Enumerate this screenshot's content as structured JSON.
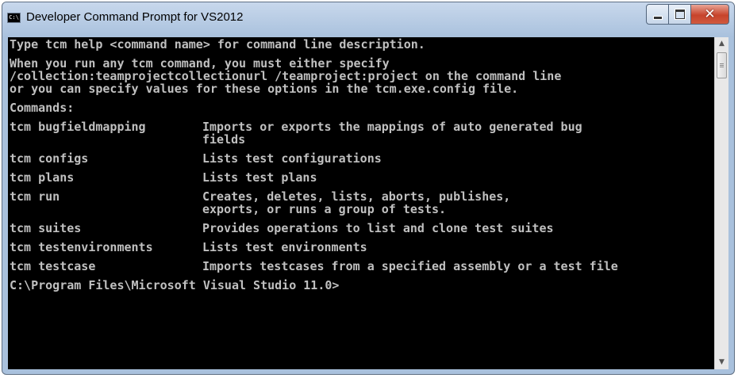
{
  "window": {
    "icon_text": "C:\\",
    "title": "Developer Command Prompt for VS2012"
  },
  "console": {
    "intro": "Type tcm help <command name> for command line description.",
    "para": [
      "When you run any tcm command, you must either specify",
      "/collection:teamprojectcollectionurl /teamproject:project on the command line",
      "or you can specify values for these options in the tcm.exe.config file."
    ],
    "commands_header": "Commands:",
    "commands": [
      {
        "name": "tcm bugfieldmapping",
        "desc": [
          "Imports or exports the mappings of auto generated bug",
          "fields"
        ]
      },
      {
        "name": "tcm configs",
        "desc": [
          "Lists test configurations"
        ]
      },
      {
        "name": "tcm plans",
        "desc": [
          "Lists test plans"
        ]
      },
      {
        "name": "tcm run",
        "desc": [
          "Creates, deletes, lists, aborts, publishes,",
          "exports, or runs a group of tests."
        ]
      },
      {
        "name": "tcm suites",
        "desc": [
          "Provides operations to list and clone test suites"
        ]
      },
      {
        "name": "tcm testenvironments",
        "desc": [
          "Lists test environments"
        ]
      },
      {
        "name": "tcm testcase",
        "desc": [
          "Imports testcases from a specified assembly or a test file"
        ]
      }
    ],
    "prompt": "C:\\Program Files\\Microsoft Visual Studio 11.0>"
  },
  "scrollbar": {
    "up_icon": "arrow-up-icon",
    "down_icon": "arrow-down-icon"
  },
  "colors": {
    "console_bg": "#000000",
    "console_text": "#c0c0c0",
    "title_bar": "#a9c1dd",
    "close_button": "#c7432b"
  }
}
